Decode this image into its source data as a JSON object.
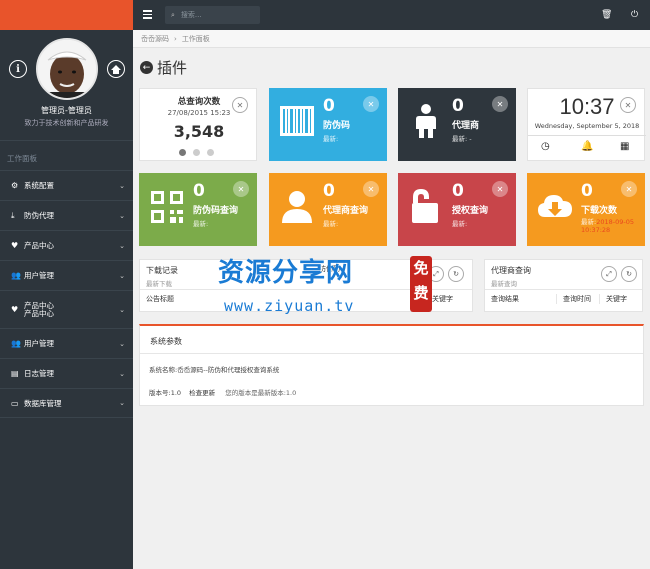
{
  "topbar": {
    "search_placeholder": "搜索..."
  },
  "breadcrumb": {
    "home": "岙岙源码",
    "current": "工作面板"
  },
  "page_title": "插件",
  "profile": {
    "name": "管理员-管理员",
    "motto": "致力于技术创新和产品研发"
  },
  "sidebar": {
    "section": "工作面板",
    "items": [
      {
        "label": "系统配置",
        "icon": "gears-icon"
      },
      {
        "label": "防伪代理",
        "icon": "download-icon"
      },
      {
        "label": "产品中心",
        "icon": "heart-icon"
      },
      {
        "label": "用户管理",
        "icon": "users-icon"
      },
      {
        "label": "产品中心",
        "label_top": "产品中心",
        "icon": "heart-icon"
      },
      {
        "label": "用户管理",
        "icon": "users-icon"
      },
      {
        "label": "日志管理",
        "icon": "log-icon"
      },
      {
        "label": "数据库管理",
        "icon": "database-icon"
      }
    ]
  },
  "stats": {
    "total": {
      "title": "总查询次数",
      "date": "27/08/2015 15:23",
      "value": "3,548"
    },
    "fake_code": {
      "value": "0",
      "label": "防伪码",
      "sub": "最新:"
    },
    "agent": {
      "value": "0",
      "label": "代理商",
      "sub": "最新: -"
    },
    "clock": {
      "time": "10:37",
      "date": "Wednesday, September 5, 2018"
    },
    "fake_query": {
      "value": "0",
      "label": "防伪码查询",
      "sub": "最新:"
    },
    "agent_query": {
      "value": "0",
      "label": "代理商查询",
      "sub": "最新:"
    },
    "auth_query": {
      "value": "0",
      "label": "授权查询",
      "sub": "最新:"
    },
    "download": {
      "value": "0",
      "label": "下载次数",
      "sub_label": "最新:",
      "sub_time": "2018-09-05 10:37:28"
    }
  },
  "panels": {
    "download": {
      "title": "下载记录",
      "sub": "最新下载",
      "col1": "公告标题",
      "col_mid": "防伪码",
      "col_key": "关键字"
    },
    "agent_q": {
      "title": "代理商查询",
      "sub": "最新查询",
      "col1": "查询结果",
      "col2": "查询时间",
      "col3": "关键字"
    }
  },
  "sysinfo": {
    "title": "系统参数",
    "name_label": "系统名称:",
    "name_value": "岙岙源码--防伪和代理授权查询系统",
    "version_label": "版本号:1.0",
    "check_link": "检查更新",
    "latest": "您的版本是最新版本:1.0"
  },
  "watermark": {
    "main": "资源分享网",
    "url": "www.ziyuan.tv",
    "seal_1": "免",
    "seal_2": "费"
  },
  "colors": {
    "sidebar": "#2d353c",
    "blue": "#32aee0",
    "dark": "#2e363d",
    "green": "#7cab4a",
    "orange": "#f59a1f",
    "red": "#c8454a",
    "accent": "#e8542b"
  }
}
